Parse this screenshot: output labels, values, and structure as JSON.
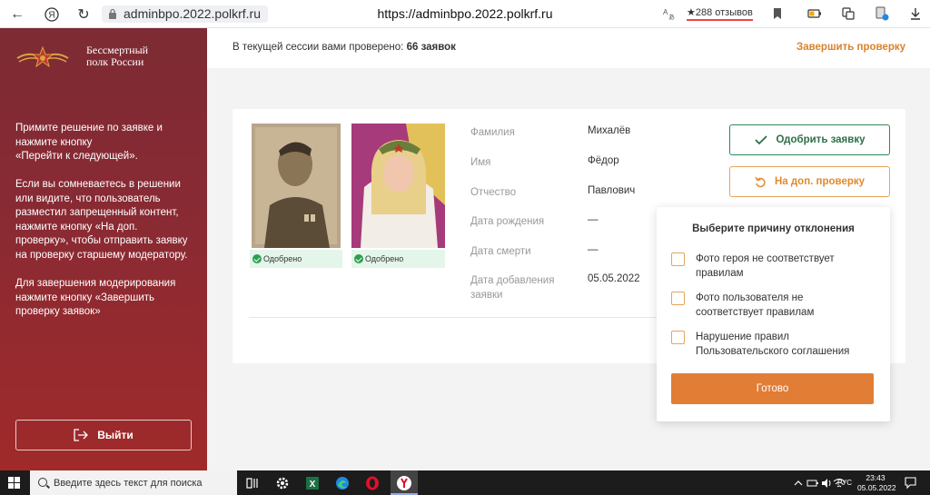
{
  "browser": {
    "url_short": "adminbpo.2022.polkrf.ru",
    "url_full": "https://adminbpo.2022.polkrf.ru",
    "reviews": "★288 отзывов"
  },
  "sidebar": {
    "logo_text": "Бессмертный\nполк России",
    "instructions": [
      "Примите решение по заявке и\nнажмите кнопку\n«Перейти к следующей».",
      "Если вы сомневаетесь в решении\nили видите, что пользователь\nразместил запрещенный контент,\nнажмите кнопку «На доп.\nпроверку», чтобы отправить заявку\nна проверку старшему модератору.",
      "Для завершения модерирования\nнажмите кнопку «Завершить\nпроверку заявок»"
    ],
    "logout_label": "Выйти"
  },
  "header": {
    "session_prefix": "В текущей сессии вами проверено:",
    "session_count": "66 заявок",
    "finish_label": "Завершить проверку"
  },
  "photos": [
    {
      "status": "Одобрено"
    },
    {
      "status": "Одобрено"
    }
  ],
  "fields": [
    {
      "label": "Фамилия",
      "value": "Михалёв"
    },
    {
      "label": "Имя",
      "value": "Фёдор"
    },
    {
      "label": "Отчество",
      "value": "Павлович"
    },
    {
      "label": "Дата рождения",
      "value": "—"
    },
    {
      "label": "Дата смерти",
      "value": "—"
    },
    {
      "label": "Дата добавления\nзаявки",
      "value": "05.05.2022"
    }
  ],
  "actions": {
    "approve_label": "Одобрить заявку",
    "recheck_label": "На доп. проверку"
  },
  "reject_popup": {
    "title": "Выберите причину отклонения",
    "options": [
      "Фото героя не соответствует\nправилам",
      "Фото пользователя не\nсоответствует правилам",
      "Нарушение правил\nПользовательского соглашения"
    ],
    "done_label": "Готово"
  },
  "taskbar": {
    "search_placeholder": "Введите здесь текст для поиска",
    "lang": "РУС",
    "time": "23:43",
    "date": "05.05.2022"
  },
  "colors": {
    "accent_orange": "#e27d35",
    "approve_green": "#2e8b57",
    "sidebar_red": "#8a2a33"
  }
}
